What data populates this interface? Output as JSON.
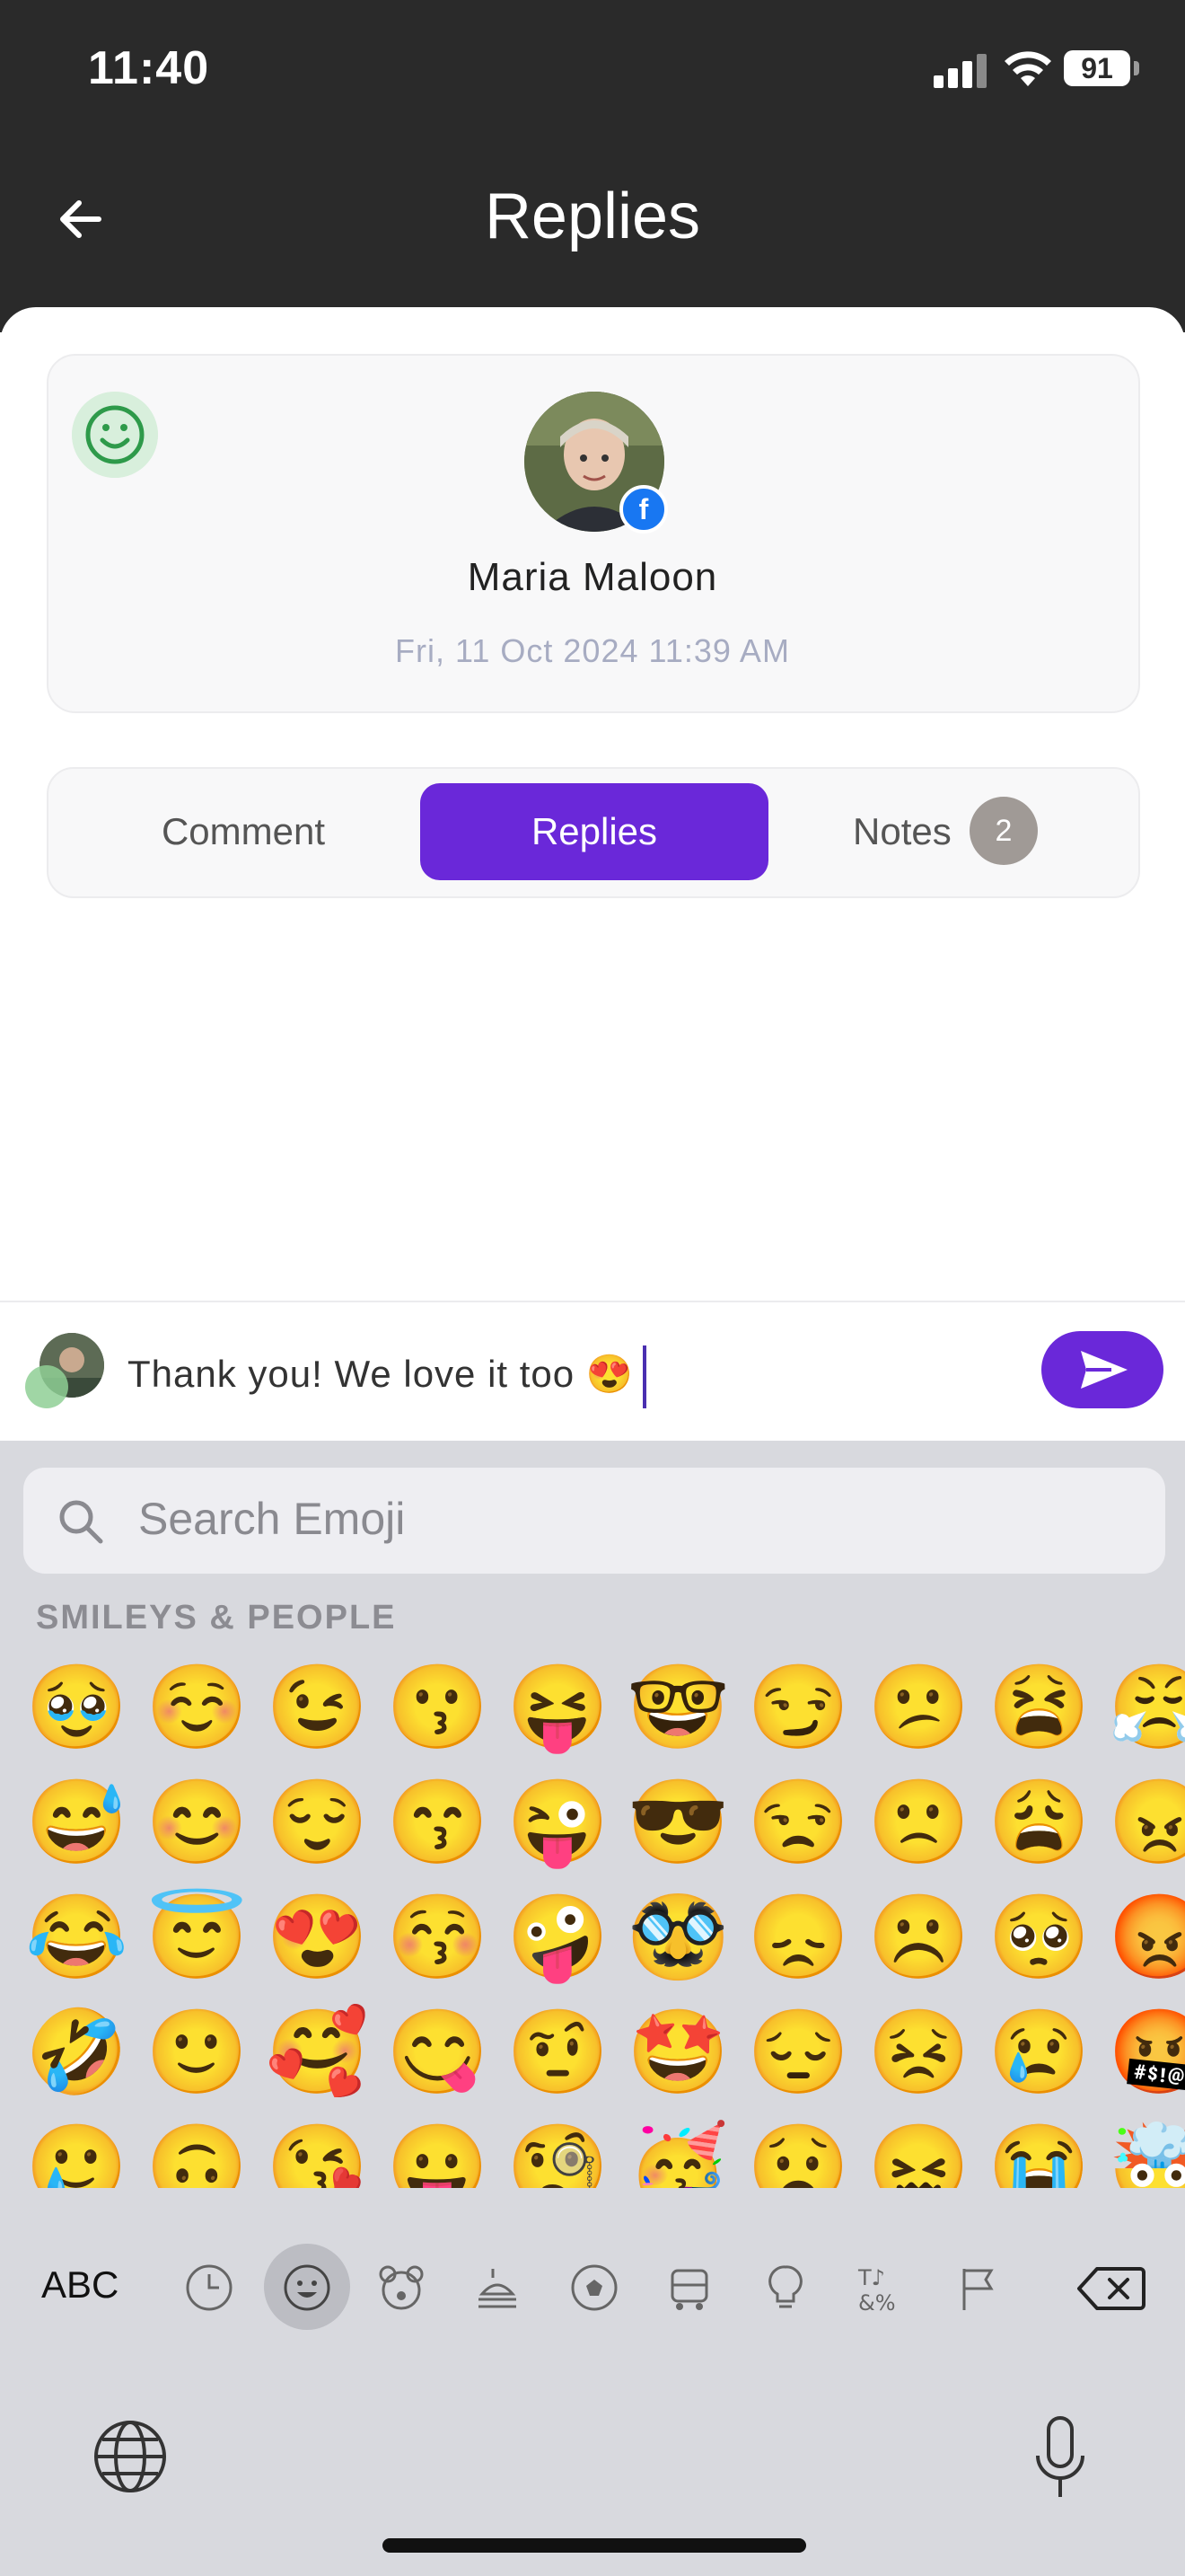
{
  "status_bar": {
    "time": "11:40",
    "battery": "91"
  },
  "header": {
    "title": "Replies"
  },
  "profile": {
    "name": "Maria Maloon",
    "date": "Fri, 11 Oct 2024 11:39 AM",
    "sentiment_icon": "smile-icon",
    "platform_icon": "facebook-icon"
  },
  "tabs": [
    {
      "label": "Comment",
      "active": false
    },
    {
      "label": "Replies",
      "active": true
    },
    {
      "label": "Notes",
      "active": false,
      "count": "2"
    }
  ],
  "composer": {
    "text": "Thank you! We love it too 😍",
    "send_icon": "send-icon"
  },
  "keyboard": {
    "search_placeholder": "Search Emoji",
    "section_label": "SMILEYS & PEOPLE",
    "emoji_rows": [
      [
        "🥹",
        "☺️",
        "😉",
        "😗",
        "😝",
        "🤓",
        "😏",
        "😕",
        "😫",
        "😤"
      ],
      [
        "😅",
        "😊",
        "😌",
        "😙",
        "😜",
        "😎",
        "😒",
        "🙁",
        "😩",
        "😠"
      ],
      [
        "😂",
        "😇",
        "😍",
        "😚",
        "🤪",
        "🥸",
        "😞",
        "☹️",
        "🥺",
        "😡"
      ],
      [
        "🤣",
        "🙂",
        "🥰",
        "😋",
        "🤨",
        "🤩",
        "😔",
        "😣",
        "😢",
        "🤬"
      ],
      [
        "🥲",
        "🙃",
        "😘",
        "😛",
        "🧐",
        "🥳",
        "😟",
        "😖",
        "😭",
        "🤯"
      ]
    ],
    "abc_label": "ABC",
    "categories": [
      "clock-icon",
      "smiley-icon",
      "bear-icon",
      "food-icon",
      "ball-icon",
      "car-icon",
      "bulb-icon",
      "symbols-icon",
      "flag-icon"
    ],
    "active_category": "smiley-icon"
  },
  "colors": {
    "accent": "#6a28d9",
    "header_bg": "#2a2a2a",
    "keyboard_bg": "#d8d9de"
  }
}
